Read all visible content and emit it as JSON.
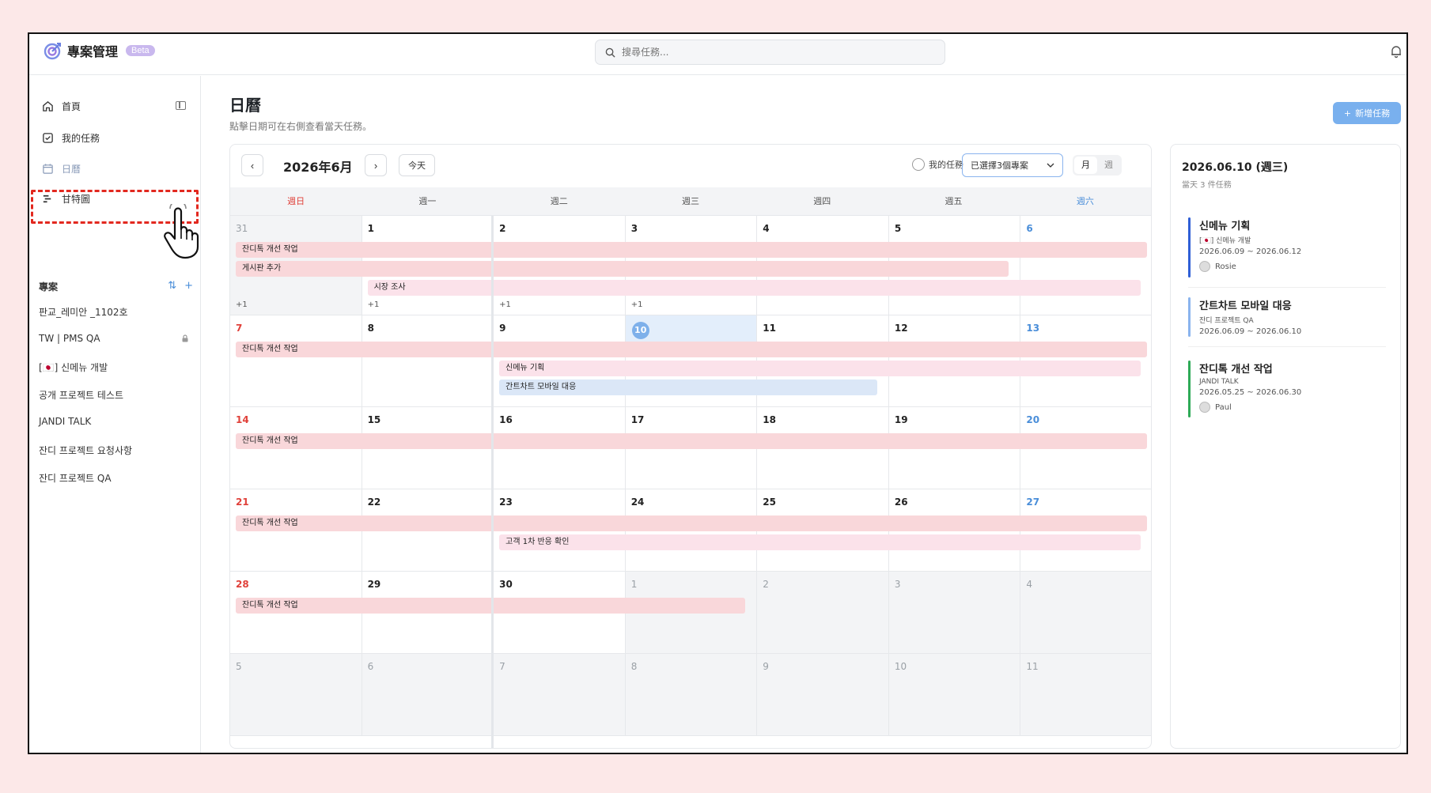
{
  "app": {
    "title": "專案管理",
    "badge": "Beta"
  },
  "search": {
    "placeholder": "搜尋任務..."
  },
  "sidebar": {
    "nav": [
      {
        "label": "首頁",
        "icon": "home-icon"
      },
      {
        "label": "我的任務",
        "icon": "checkbox-icon"
      },
      {
        "label": "日曆",
        "icon": "calendar-icon"
      },
      {
        "label": "甘特圖",
        "icon": "gantt-icon"
      }
    ],
    "projects_title": "專案",
    "projects": [
      {
        "name": "판교_레미안 _1102호",
        "locked": false
      },
      {
        "name": "TW | PMS QA",
        "locked": true
      },
      {
        "name": "[🇯🇵] 신메뉴 개발",
        "locked": false
      },
      {
        "name": "공개 프로젝트 테스트",
        "locked": false
      },
      {
        "name": "JANDI TALK",
        "locked": false
      },
      {
        "name": "잔디 프로젝트 요청사항",
        "locked": false
      },
      {
        "name": "잔디 프로젝트 QA",
        "locked": false
      }
    ]
  },
  "page": {
    "title": "日曆",
    "subtitle": "點擊日期可在右側查看當天任務。",
    "new_task": "新增任務"
  },
  "calendar": {
    "month_label": "2026年6月",
    "today_btn": "今天",
    "prev": "‹",
    "next": "›",
    "my_tasks": "我的任務",
    "project_filter": "已選擇3個專案",
    "view_month": "月",
    "view_week": "週",
    "weekdays": [
      "週日",
      "週一",
      "週二",
      "週三",
      "週四",
      "週五",
      "週六"
    ],
    "weeks": [
      {
        "days": [
          "31",
          "1",
          "2",
          "3",
          "4",
          "5",
          "6"
        ],
        "dim": [
          0
        ],
        "more": [
          {
            "col": 0,
            "text": "+1"
          },
          {
            "col": 1,
            "text": "+1"
          },
          {
            "col": 2,
            "text": "+1"
          },
          {
            "col": 3,
            "text": "+1"
          }
        ],
        "bars": [
          {
            "label": "잔디톡 개선 작업",
            "start": 0,
            "end": 6,
            "row": 0,
            "color": "red"
          },
          {
            "label": "게시판 추가",
            "start": 0,
            "end": 4.95,
            "row": 1,
            "color": "red"
          },
          {
            "label": "시장 조사",
            "start": 1,
            "end": 5.95,
            "row": 2,
            "color": "pink"
          }
        ]
      },
      {
        "days": [
          "7",
          "8",
          "9",
          "10",
          "11",
          "12",
          "13"
        ],
        "dim": [],
        "today": 3,
        "more": [],
        "bars": [
          {
            "label": "잔디톡 개선 작업",
            "start": 0,
            "end": 6,
            "row": 0,
            "color": "red"
          },
          {
            "label": "신메뉴 기획",
            "start": 2,
            "end": 5.95,
            "row": 1,
            "color": "pink"
          },
          {
            "label": "간트차트 모바일 대응",
            "start": 2,
            "end": 3.95,
            "row": 2,
            "color": "blue"
          }
        ]
      },
      {
        "days": [
          "14",
          "15",
          "16",
          "17",
          "18",
          "19",
          "20"
        ],
        "dim": [],
        "more": [],
        "bars": [
          {
            "label": "잔디톡 개선 작업",
            "start": 0,
            "end": 6,
            "row": 0,
            "color": "red"
          }
        ]
      },
      {
        "days": [
          "21",
          "22",
          "23",
          "24",
          "25",
          "26",
          "27"
        ],
        "dim": [],
        "more": [],
        "bars": [
          {
            "label": "잔디톡 개선 작업",
            "start": 0,
            "end": 6,
            "row": 0,
            "color": "red"
          },
          {
            "label": "고객 1차 반응 확인",
            "start": 2,
            "end": 5.95,
            "row": 1,
            "color": "pink"
          }
        ]
      },
      {
        "days": [
          "28",
          "29",
          "30",
          "1",
          "2",
          "3",
          "4"
        ],
        "dim": [
          3,
          4,
          5,
          6
        ],
        "more": [],
        "bars": [
          {
            "label": "잔디톡 개선 작업",
            "start": 0,
            "end": 2.95,
            "row": 0,
            "color": "red"
          }
        ]
      },
      {
        "days": [
          "5",
          "6",
          "7",
          "8",
          "9",
          "10",
          "11"
        ],
        "dim": [
          0,
          1,
          2,
          3,
          4,
          5,
          6
        ],
        "more": [],
        "bars": []
      }
    ]
  },
  "side_panel": {
    "date": "2026.06.10 (週三)",
    "count": "當天 3 件任務",
    "tasks": [
      {
        "title": "신메뉴 기획",
        "project": "[🇯🇵] 신메뉴 개발",
        "date": "2026.06.09 ~ 2026.06.12",
        "user": "Rosie",
        "color": "#2f5fd6"
      },
      {
        "title": "간트차트 모바일 대응",
        "project": "잔디 프로젝트 QA",
        "date": "2026.06.09 ~ 2026.06.10",
        "user": "",
        "color": "#8ab4ee"
      },
      {
        "title": "잔디톡 개선 작업",
        "project": "JANDI TALK",
        "date": "2026.05.25 ~ 2026.06.30",
        "user": "Paul",
        "color": "#2eaa57"
      }
    ]
  },
  "colors": {
    "accent": "#79b0ee",
    "today": "#7eb0ea",
    "sunday": "#e0413a",
    "saturday": "#4a8ed9",
    "highlight": "#e2281f"
  }
}
